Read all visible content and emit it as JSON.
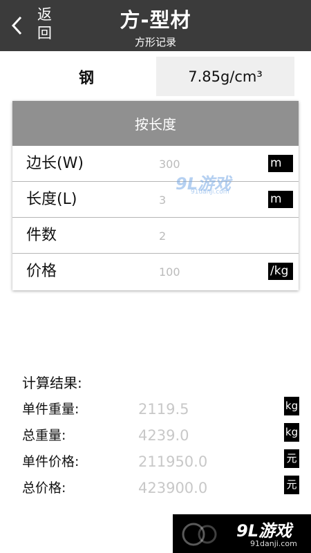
{
  "header": {
    "back_label": "返回",
    "title": "方-型材",
    "subtitle": "方形记录"
  },
  "material": {
    "name": "钢",
    "density": "7.85g/cm³"
  },
  "mode": {
    "label": "按长度"
  },
  "fields": [
    {
      "label": "边长(W)",
      "value": "300",
      "unit": "m"
    },
    {
      "label": "长度(L)",
      "value": "3",
      "unit": "m"
    },
    {
      "label": "件数",
      "value": "2",
      "unit": ""
    },
    {
      "label": "价格",
      "value": "100",
      "unit": "/kg"
    }
  ],
  "results": {
    "title": "计算结果:",
    "items": [
      {
        "label": "单件重量:",
        "value": "2119.5",
        "unit": "kg"
      },
      {
        "label": "总重量:",
        "value": "4239.0",
        "unit": "kg"
      },
      {
        "label": "单件价格:",
        "value": "211950.0",
        "unit": "元"
      },
      {
        "label": "总价格:",
        "value": "423900.0",
        "unit": "元"
      }
    ]
  },
  "watermark": {
    "brand": "9L游戏",
    "url": "91danji.com"
  },
  "colors": {
    "header_bg": "#3b3b3b",
    "section_header_bg": "#909090",
    "density_bg": "#efefef",
    "value_text": "#c8c8c8",
    "unit_badge_bg": "#000000"
  },
  "icons": {
    "back": "chevron-left-icon"
  }
}
